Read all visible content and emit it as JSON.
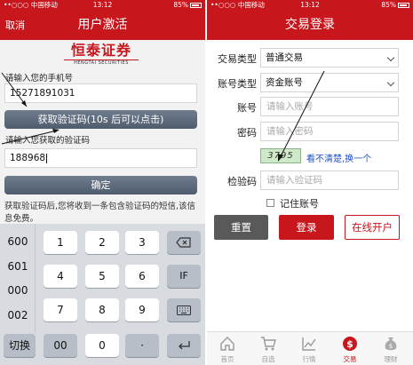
{
  "left": {
    "status": {
      "carrier": "••○○○ 中国移动",
      "time": "13:12",
      "battery": "85%"
    },
    "header": {
      "cancel": "取消",
      "title": "用户激活"
    },
    "logo": {
      "cn": "恒泰证券",
      "en": "HENGTAI SECURITIES"
    },
    "phone_label": "请输入您的手机号",
    "phone_value": "15271891031",
    "get_code_button": "获取验证码(10s 后可以点击)",
    "code_label": "请输入您获取的验证码",
    "code_value": "188968",
    "confirm_button": "确定",
    "hint": "获取验证码后,您将收到一条包含验证码的短信,该信息免费。",
    "keypad": {
      "side": [
        "600",
        "601",
        "000",
        "002",
        "切换"
      ],
      "digits": [
        "1",
        "2",
        "3",
        "4",
        "5",
        "6",
        "7",
        "8",
        "9"
      ],
      "bottom": [
        "00",
        "0",
        "·"
      ],
      "icons": {
        "delete": "backspace-icon",
        "keyboard": "keyboard-icon",
        "enter": "enter-icon"
      },
      "if_label": "IF"
    }
  },
  "right": {
    "status": {
      "carrier": "••○○○ 中国移动",
      "time": "13:12",
      "battery": "85%"
    },
    "header": {
      "title": "交易登录"
    },
    "trade_type_label": "交易类型",
    "trade_type_value": "普通交易",
    "account_type_label": "账号类型",
    "account_type_value": "资金账号",
    "account_label": "账号",
    "account_placeholder": "请输入账号",
    "password_label": "密码",
    "password_placeholder": "请输入密码",
    "captcha_text": "3795",
    "captcha_refresh": "看不清楚,换一个",
    "verify_label": "检验码",
    "verify_placeholder": "请输入验证码",
    "remember_label": "记住账号",
    "buttons": {
      "reset": "重置",
      "login": "登录",
      "online": "在线开户"
    },
    "tabs": [
      {
        "label": "首页",
        "icon": "home-icon"
      },
      {
        "label": "自选",
        "icon": "cart-icon"
      },
      {
        "label": "行情",
        "icon": "chart-icon"
      },
      {
        "label": "交易",
        "icon": "dollar-icon"
      },
      {
        "label": "理财",
        "icon": "moneybag-icon"
      }
    ],
    "active_tab": "交易"
  },
  "colors": {
    "brand_red": "#c8161d",
    "button_grey": "#5a6778",
    "link_blue": "#1f4fc7"
  }
}
